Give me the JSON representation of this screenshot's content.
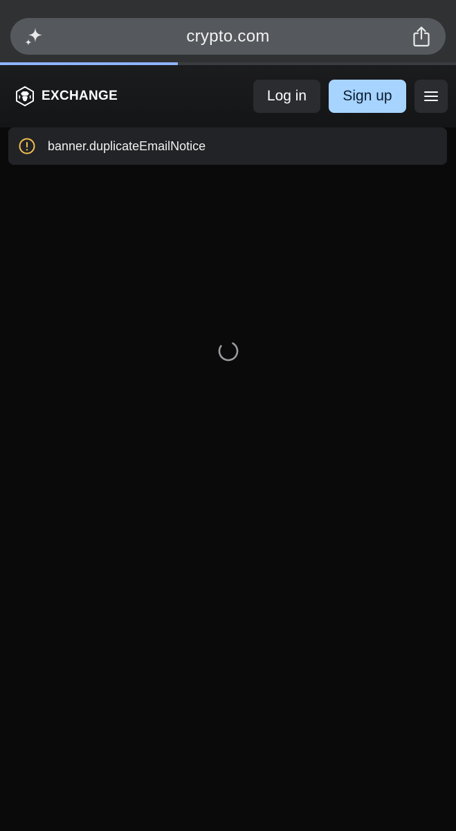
{
  "browser": {
    "url": "crypto.com",
    "left_icon": "sparkle-icon",
    "right_icon": "share-icon",
    "load_progress_fraction": 0.39
  },
  "header": {
    "brand_text": "EXCHANGE",
    "logo_icon": "crypto-lion-shield-logo",
    "login_label": "Log in",
    "signup_label": "Sign up",
    "menu_icon": "hamburger-menu-icon"
  },
  "banner": {
    "icon": "warning-circle-icon",
    "text": "banner.duplicateEmailNotice"
  },
  "main": {
    "loading_icon": "loading-spinner-icon"
  },
  "colors": {
    "accent": "#a6d4ff",
    "progress": "#8fb4ff",
    "warning": "#f2c14e",
    "background": "#0a0a0a"
  }
}
